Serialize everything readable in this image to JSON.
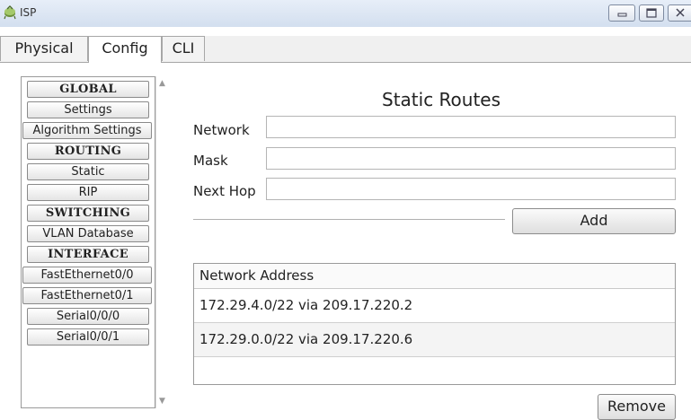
{
  "window": {
    "title": "ISP",
    "icon": "isp-router-icon",
    "controls": [
      "minimize-icon",
      "maximize-icon",
      "close-icon"
    ]
  },
  "tabs": [
    {
      "label": "Physical",
      "active": false
    },
    {
      "label": "Config",
      "active": true
    },
    {
      "label": "CLI",
      "active": false
    }
  ],
  "sidebar": {
    "items": [
      {
        "label": "GLOBAL",
        "header": true
      },
      {
        "label": "Settings",
        "header": false
      },
      {
        "label": "Algorithm Settings",
        "header": false
      },
      {
        "label": "ROUTING",
        "header": true
      },
      {
        "label": "Static",
        "header": false
      },
      {
        "label": "RIP",
        "header": false
      },
      {
        "label": "SWITCHING",
        "header": true
      },
      {
        "label": "VLAN Database",
        "header": false
      },
      {
        "label": "INTERFACE",
        "header": true
      },
      {
        "label": "FastEthernet0/0",
        "header": false
      },
      {
        "label": "FastEthernet0/1",
        "header": false
      },
      {
        "label": "Serial0/0/0",
        "header": false
      },
      {
        "label": "Serial0/0/1",
        "header": false
      }
    ]
  },
  "main": {
    "heading": "Static Routes",
    "form": {
      "network_label": "Network",
      "network_value": "",
      "mask_label": "Mask",
      "mask_value": "",
      "nexthop_label": "Next Hop",
      "nexthop_value": ""
    },
    "add_button": "Add",
    "table": {
      "header": "Network Address",
      "rows": [
        "172.29.4.0/22 via 209.17.220.2",
        "172.29.0.0/22 via 209.17.220.6"
      ]
    },
    "remove_button": "Remove"
  },
  "colors": {
    "titlebar": "#dce6f3",
    "border": "#9a9a9a",
    "button": "#e8e8e8"
  }
}
